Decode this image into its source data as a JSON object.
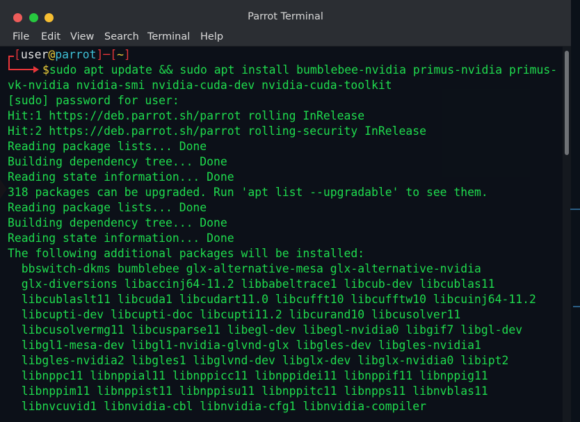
{
  "window": {
    "title": "Parrot Terminal"
  },
  "menu": [
    "File",
    "Edit",
    "View",
    "Search",
    "Terminal",
    "Help"
  ],
  "prompt": {
    "bracket_open": "[",
    "user": "user",
    "at": "@",
    "host": "parrot",
    "bracket_close": "]",
    "dash": "─",
    "dir_open": "[",
    "dir": "~",
    "dir_close": "]",
    "dollar": "$",
    "command": "sudo apt update && sudo apt install bumblebee-nvidia primus-nvidia primus-",
    "command_cont": "vk-nvidia nvidia-smi nvidia-cuda-dev nvidia-cuda-toolkit"
  },
  "output": [
    "[sudo] password for user:",
    "Hit:1 https://deb.parrot.sh/parrot rolling InRelease",
    "Hit:2 https://deb.parrot.sh/parrot rolling-security InRelease",
    "Reading package lists... Done",
    "Building dependency tree... Done",
    "Reading state information... Done",
    "318 packages can be upgraded. Run 'apt list --upgradable' to see them.",
    "Reading package lists... Done",
    "Building dependency tree... Done",
    "Reading state information... Done",
    "The following additional packages will be installed:",
    "  bbswitch-dkms bumblebee glx-alternative-mesa glx-alternative-nvidia",
    "  glx-diversions libaccinj64-11.2 libbabeltrace1 libcub-dev libcublas11",
    "  libcublaslt11 libcuda1 libcudart11.0 libcufft10 libcufftw10 libcuinj64-11.2",
    "  libcupti-dev libcupti-doc libcupti11.2 libcurand10 libcusolver11",
    "  libcusolvermg11 libcusparse11 libegl-dev libegl-nvidia0 libgif7 libgl-dev",
    "  libgl1-mesa-dev libgl1-nvidia-glvnd-glx libgles-dev libgles-nvidia1",
    "  libgles-nvidia2 libgles1 libglvnd-dev libglx-dev libglx-nvidia0 libipt2",
    "  libnppc11 libnppial11 libnppicc11 libnppidei11 libnppif11 libnppig11",
    "  libnppim11 libnppist11 libnppisu11 libnppitc11 libnpps11 libnvblas11",
    "  libnvcuvid1 libnvidia-cbl libnvidia-cfg1 libnvidia-compiler"
  ],
  "colors": {
    "prompt": "#e8363a",
    "user_host": "#e4e4e4",
    "at": "#eccf3a",
    "text": "#1fdc4e"
  }
}
